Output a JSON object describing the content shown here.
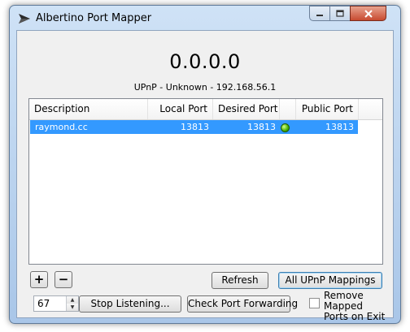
{
  "window": {
    "title": "Albertino Port Mapper",
    "minimize_icon": "minimize-icon",
    "maximize_icon": "maximize-icon",
    "close_icon": "close-icon"
  },
  "status": {
    "external_ip": "0.0.0.0",
    "upnp_info": "UPnP - Unknown - 192.168.56.1"
  },
  "table": {
    "columns": [
      "Description",
      "Local Port",
      "Desired Port",
      "",
      "Public Port"
    ],
    "rows": [
      {
        "description": "raymond.cc",
        "local_port": "13813",
        "desired_port": "13813",
        "status_icon": "green-status-icon",
        "public_port": "13813"
      }
    ]
  },
  "buttons": {
    "add": "+",
    "remove": "−",
    "refresh": "Refresh",
    "all_mappings": "All UPnP Mappings",
    "stop_listening": "Stop Listening...",
    "check_forwarding": "Check Port Forwarding"
  },
  "spinner": {
    "value": "67"
  },
  "checkbox": {
    "label_line1": "Remove Mapped",
    "label_line2": "Ports on Exit",
    "checked": false
  },
  "colors": {
    "selection": "#3399ff",
    "status_ok": "#45b000",
    "title_bar": "#bcd4ef"
  }
}
